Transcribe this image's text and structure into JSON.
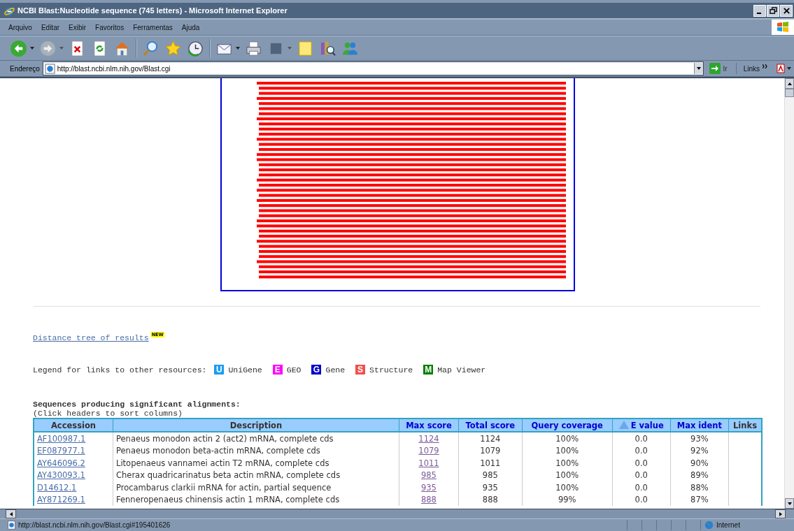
{
  "window": {
    "title": "NCBI Blast:Nucleotide sequence (745 letters) - Microsoft Internet Explorer"
  },
  "menu": [
    "Arquivo",
    "Editar",
    "Exibir",
    "Favoritos",
    "Ferramentas",
    "Ajuda"
  ],
  "address_bar": {
    "label": "Endereço",
    "url": "http://blast.ncbi.nlm.nih.gov/Blast.cgi",
    "go": "Ir",
    "links": "Links"
  },
  "page": {
    "distance_tree_link": "Distance tree of results",
    "new_badge": "NEW",
    "legend_label": "Legend for links to other resources:",
    "legend": [
      {
        "letter": "U",
        "label": "UniGene",
        "color": "#1a9cf0"
      },
      {
        "letter": "E",
        "label": "GEO",
        "color": "#ff00ff"
      },
      {
        "letter": "G",
        "label": "Gene",
        "color": "#0000cc"
      },
      {
        "letter": "S",
        "label": "Structure",
        "color": "#f05050"
      },
      {
        "letter": "M",
        "label": "Map Viewer",
        "color": "#008000"
      }
    ],
    "heading": "Sequences producing significant alignments:",
    "subheading": "(Click headers to sort columns)",
    "table": {
      "columns": [
        {
          "label": "Accession",
          "sortable": false,
          "sorted": false
        },
        {
          "label": "Description",
          "sortable": false,
          "sorted": false
        },
        {
          "label": "Max score",
          "sortable": true,
          "sorted": false
        },
        {
          "label": "Total score",
          "sortable": true,
          "sorted": false
        },
        {
          "label": "Query coverage",
          "sortable": true,
          "sorted": false
        },
        {
          "label": "E value",
          "sortable": true,
          "sorted": true
        },
        {
          "label": "Max ident",
          "sortable": true,
          "sorted": false
        },
        {
          "label": "Links",
          "sortable": false,
          "sorted": false
        }
      ],
      "rows": [
        {
          "accession": "AF100987.1",
          "description": "Penaeus monodon actin 2 (act2) mRNA, complete cds",
          "max_score": "1124",
          "total_score": "1124",
          "query_coverage": "100%",
          "e_value": "0.0",
          "max_ident": "93%"
        },
        {
          "accession": "EF087977.1",
          "description": "Penaeus monodon beta-actin mRNA, complete cds",
          "max_score": "1079",
          "total_score": "1079",
          "query_coverage": "100%",
          "e_value": "0.0",
          "max_ident": "92%"
        },
        {
          "accession": "AY646096.2",
          "description": "Litopenaeus vannamei actin T2 mRNA, complete cds",
          "max_score": "1011",
          "total_score": "1011",
          "query_coverage": "100%",
          "e_value": "0.0",
          "max_ident": "90%"
        },
        {
          "accession": "AY430093.1",
          "description": "Cherax quadricarinatus beta actin mRNA, complete cds",
          "max_score": "985",
          "total_score": "985",
          "query_coverage": "100%",
          "e_value": "0.0",
          "max_ident": "89%"
        },
        {
          "accession": "D14612.1",
          "description": "Procambarus clarkii mRNA for actin, partial sequence",
          "max_score": "935",
          "total_score": "935",
          "query_coverage": "100%",
          "e_value": "0.0",
          "max_ident": "88%"
        },
        {
          "accession": "AY871269.1",
          "description": "Fenneropenaeus chinensis actin 1 mRNA, complete cds",
          "max_score": "888",
          "total_score": "888",
          "query_coverage": "99%",
          "e_value": "0.0",
          "max_ident": "87%"
        }
      ]
    }
  },
  "status_bar": {
    "url": "http://blast.ncbi.nlm.nih.gov/Blast.cgi#195401626",
    "zone": "Internet"
  }
}
